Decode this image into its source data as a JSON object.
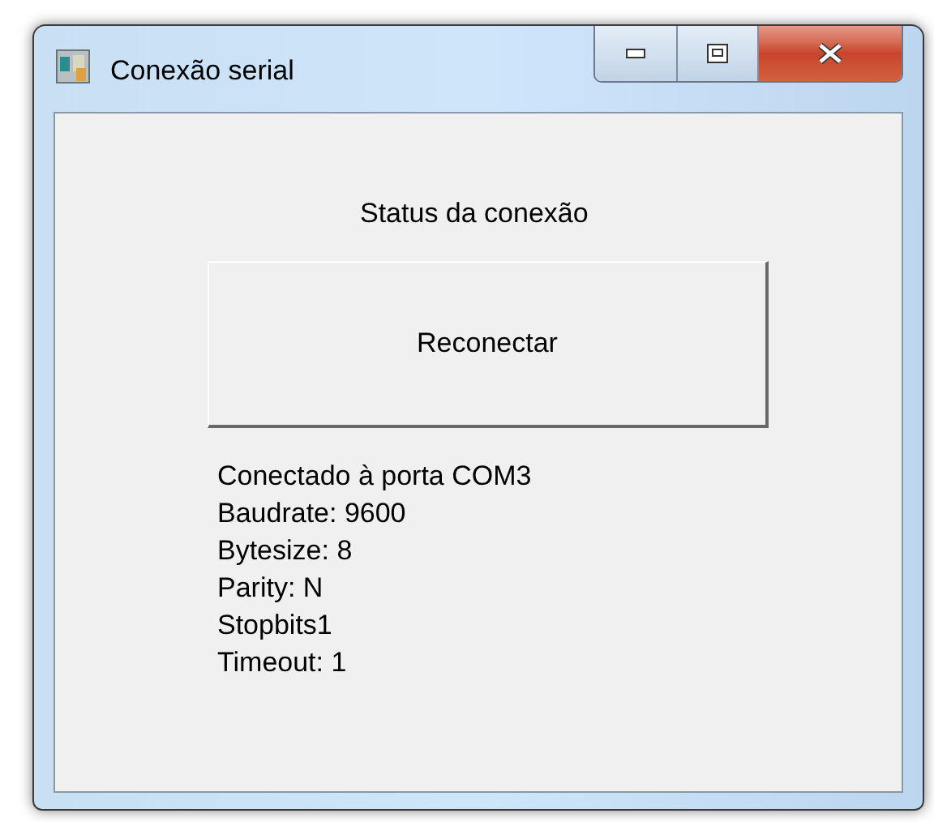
{
  "window": {
    "title": "Conexão serial"
  },
  "status_label": "Status da conexão",
  "reconnect_button": "Reconectar",
  "info_lines": [
    "Conectado à porta COM3",
    "Baudrate: 9600",
    "Bytesize: 8",
    "Parity: N",
    "Stopbits1",
    "Timeout: 1"
  ]
}
